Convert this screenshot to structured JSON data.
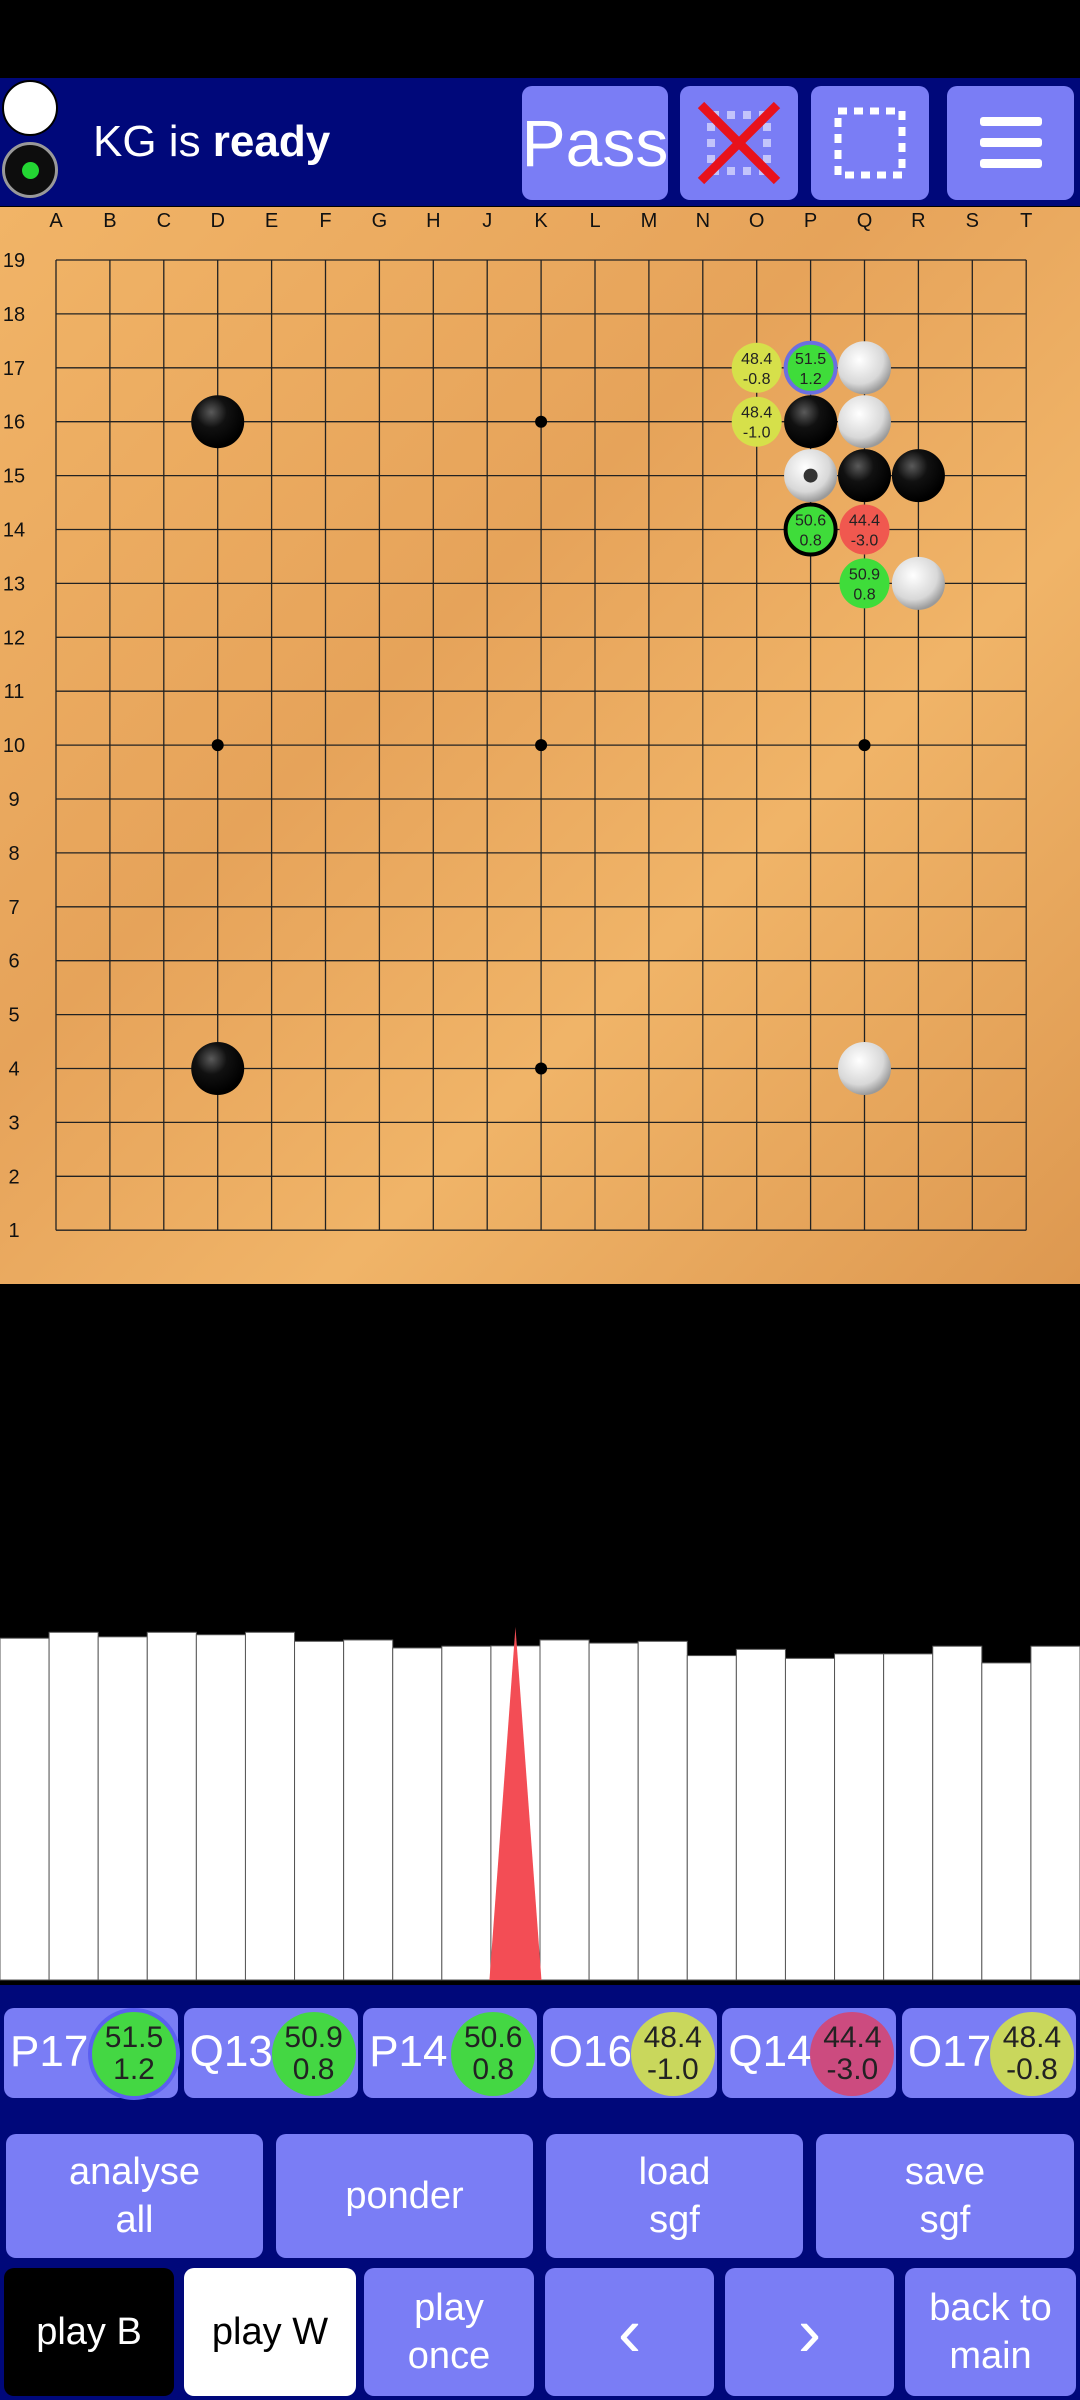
{
  "header": {
    "status_prefix": "KG is ",
    "status_state": "ready",
    "pass_label": "Pass",
    "icons": [
      "remove-stone-icon",
      "select-area-icon",
      "hamburger-menu-icon"
    ]
  },
  "board": {
    "size": 19,
    "columns": [
      "A",
      "B",
      "C",
      "D",
      "E",
      "F",
      "G",
      "H",
      "J",
      "K",
      "L",
      "M",
      "N",
      "O",
      "P",
      "Q",
      "R",
      "S",
      "T"
    ],
    "rows": [
      "19",
      "18",
      "17",
      "16",
      "15",
      "14",
      "13",
      "12",
      "11",
      "10",
      "9",
      "8",
      "7",
      "6",
      "5",
      "4",
      "3",
      "2",
      "1"
    ],
    "stones": {
      "black": [
        "D16",
        "P16",
        "Q15",
        "R15",
        "D4"
      ],
      "white": [
        "Q17",
        "Q16",
        "P15",
        "R13",
        "Q4"
      ]
    },
    "last_move": "P15",
    "candidates": [
      {
        "point": "P17",
        "line1": "51.5",
        "line2": "1.2",
        "color": "#3fdc3a"
      },
      {
        "point": "O17",
        "line1": "48.4",
        "line2": "-0.8",
        "color": "#d6e04a"
      },
      {
        "point": "O16",
        "line1": "48.4",
        "line2": "-1.0",
        "color": "#d6e04a"
      },
      {
        "point": "P14",
        "line1": "50.6",
        "line2": "0.8",
        "color": "#3fdc3a"
      },
      {
        "point": "Q14",
        "line1": "44.4",
        "line2": "-3.0",
        "color": "#f0584f"
      },
      {
        "point": "Q13",
        "line1": "50.9",
        "line2": "0.8",
        "color": "#3fdc3a"
      }
    ]
  },
  "history": {
    "white_levels": [
      0.983,
      1.0,
      0.987,
      1.0,
      0.993,
      1.0,
      0.974,
      0.978,
      0.955,
      0.96,
      0.961,
      0.978,
      0.969,
      0.974,
      0.933,
      0.951,
      0.925,
      0.938,
      0.938,
      0.96,
      0.912,
      0.96
    ],
    "marker_move": 10
  },
  "moves": [
    {
      "label": "P17",
      "line1": "51.5",
      "line2": "1.2",
      "color": "#44d743"
    },
    {
      "label": "Q13",
      "line1": "50.9",
      "line2": "0.8",
      "color": "#44d743"
    },
    {
      "label": "P14",
      "line1": "50.6",
      "line2": "0.8",
      "color": "#44d743"
    },
    {
      "label": "O16",
      "line1": "48.4",
      "line2": "-1.0",
      "color": "#c9d75c"
    },
    {
      "label": "Q14",
      "line1": "44.4",
      "line2": "-3.0",
      "color": "#cc4b7f"
    },
    {
      "label": "O17",
      "line1": "48.4",
      "line2": "-0.8",
      "color": "#c9d75c"
    }
  ],
  "actions": {
    "analyse_all": [
      "analyse",
      "all"
    ],
    "ponder": "ponder",
    "load_sgf": [
      "load",
      "sgf"
    ],
    "save_sgf": [
      "save",
      "sgf"
    ],
    "play_b": "play B",
    "play_w": "play W",
    "play_once": [
      "play",
      "once"
    ],
    "prev": "‹",
    "next": "›",
    "back_to_main": [
      "back to",
      "main"
    ]
  }
}
